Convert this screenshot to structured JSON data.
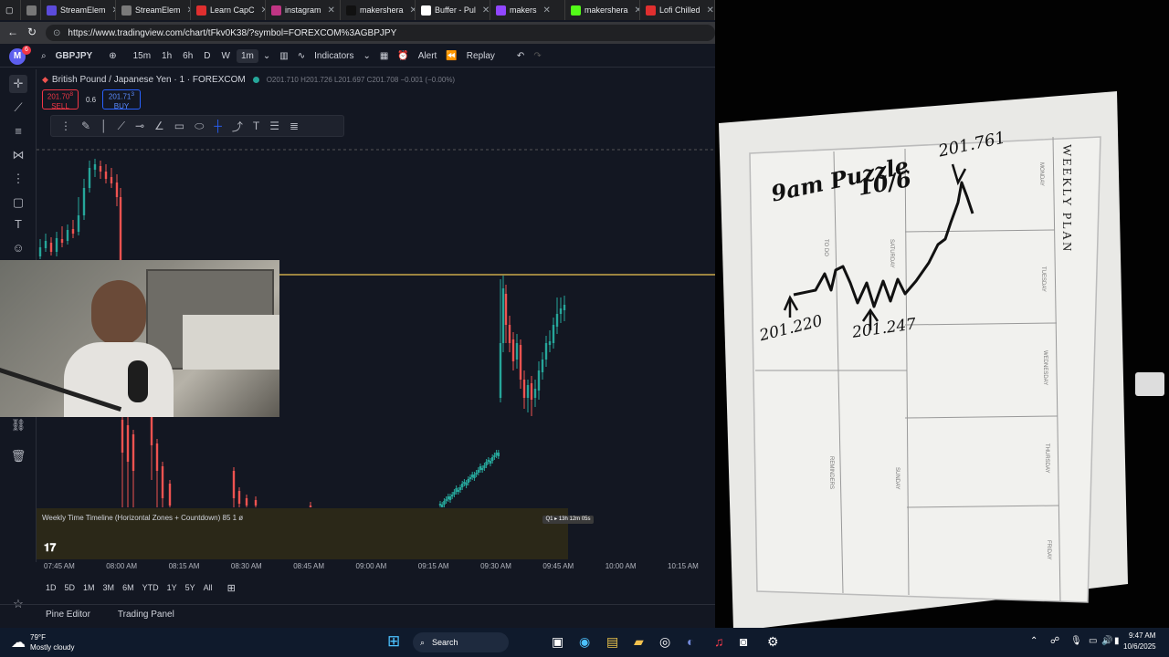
{
  "browser": {
    "tabs": [
      {
        "label": "StreamElem",
        "color": "#5b4bdb"
      },
      {
        "label": "StreamElem",
        "color": "#7a7a7a"
      },
      {
        "label": "Learn CapC",
        "color": "#e02f2f"
      },
      {
        "label": "instagram",
        "color": "#c13584"
      },
      {
        "label": "makershera",
        "color": "#111111"
      },
      {
        "label": "Buffer - Pul",
        "color": "#ffffff"
      },
      {
        "label": "makers",
        "color": "#9146ff"
      },
      {
        "label": "makershera",
        "color": "#53fc18"
      },
      {
        "label": "Lofi Chilled",
        "color": "#e02f2f"
      }
    ],
    "url": "https://www.tradingview.com/chart/tFkv0K38/?symbol=FOREXCOM%3AGBPJPY"
  },
  "tv_header": {
    "symbol": "GBPJPY",
    "intervals": [
      "15m",
      "1h",
      "6h",
      "D",
      "W",
      "1m"
    ],
    "indicators_label": "Indicators",
    "alert_label": "Alert",
    "replay_label": "Replay",
    "avatar_letter": "M",
    "badge": "6"
  },
  "legend": {
    "title": "British Pound / Japanese Yen · 1 · FOREXCOM",
    "ohlc": "O201.710 H201.726 L201.697 C201.708 −0.001 (−0.00%)",
    "sell_price": "201.70",
    "sell_sup": "8",
    "sell_label": "SELL",
    "spread": "0.6",
    "buy_price": "201.71",
    "buy_sup": "3",
    "buy_label": "BUY"
  },
  "timeline": {
    "label": "Weekly Time Timeline (Horizontal Zones + Countdown) 85 1 ø",
    "countdown": "Q1 ▸ 13h 12m 05s"
  },
  "xaxis_labels": [
    "07:45 AM",
    "08:00 AM",
    "08:15 AM",
    "08:30 AM",
    "08:45 AM",
    "09:00 AM",
    "09:15 AM",
    "09:30 AM",
    "09:45 AM",
    "10:00 AM",
    "10:15 AM"
  ],
  "ranges": [
    "1D",
    "5D",
    "1M",
    "3M",
    "6M",
    "YTD",
    "1Y",
    "5Y",
    "All"
  ],
  "panels": {
    "pine": "Pine Editor",
    "trading": "Trading Panel"
  },
  "whiteboard": {
    "title": "WEEKLY PLAN",
    "days": [
      "MONDAY",
      "TUESDAY",
      "WEDNESDAY",
      "THURSDAY",
      "FRIDAY",
      "SATURDAY",
      "SUNDAY"
    ],
    "sections": [
      "TO DO",
      "REMINDERS"
    ],
    "note_title": "9am Puzzle",
    "note_date": "10/6",
    "price_top": "201.761",
    "price_left": "201.220",
    "price_mid": "201.247"
  },
  "taskbar": {
    "temp": "79°F",
    "weather": "Mostly cloudy",
    "search": "Search",
    "time": "9:47 AM",
    "date": "10/6/2025"
  }
}
